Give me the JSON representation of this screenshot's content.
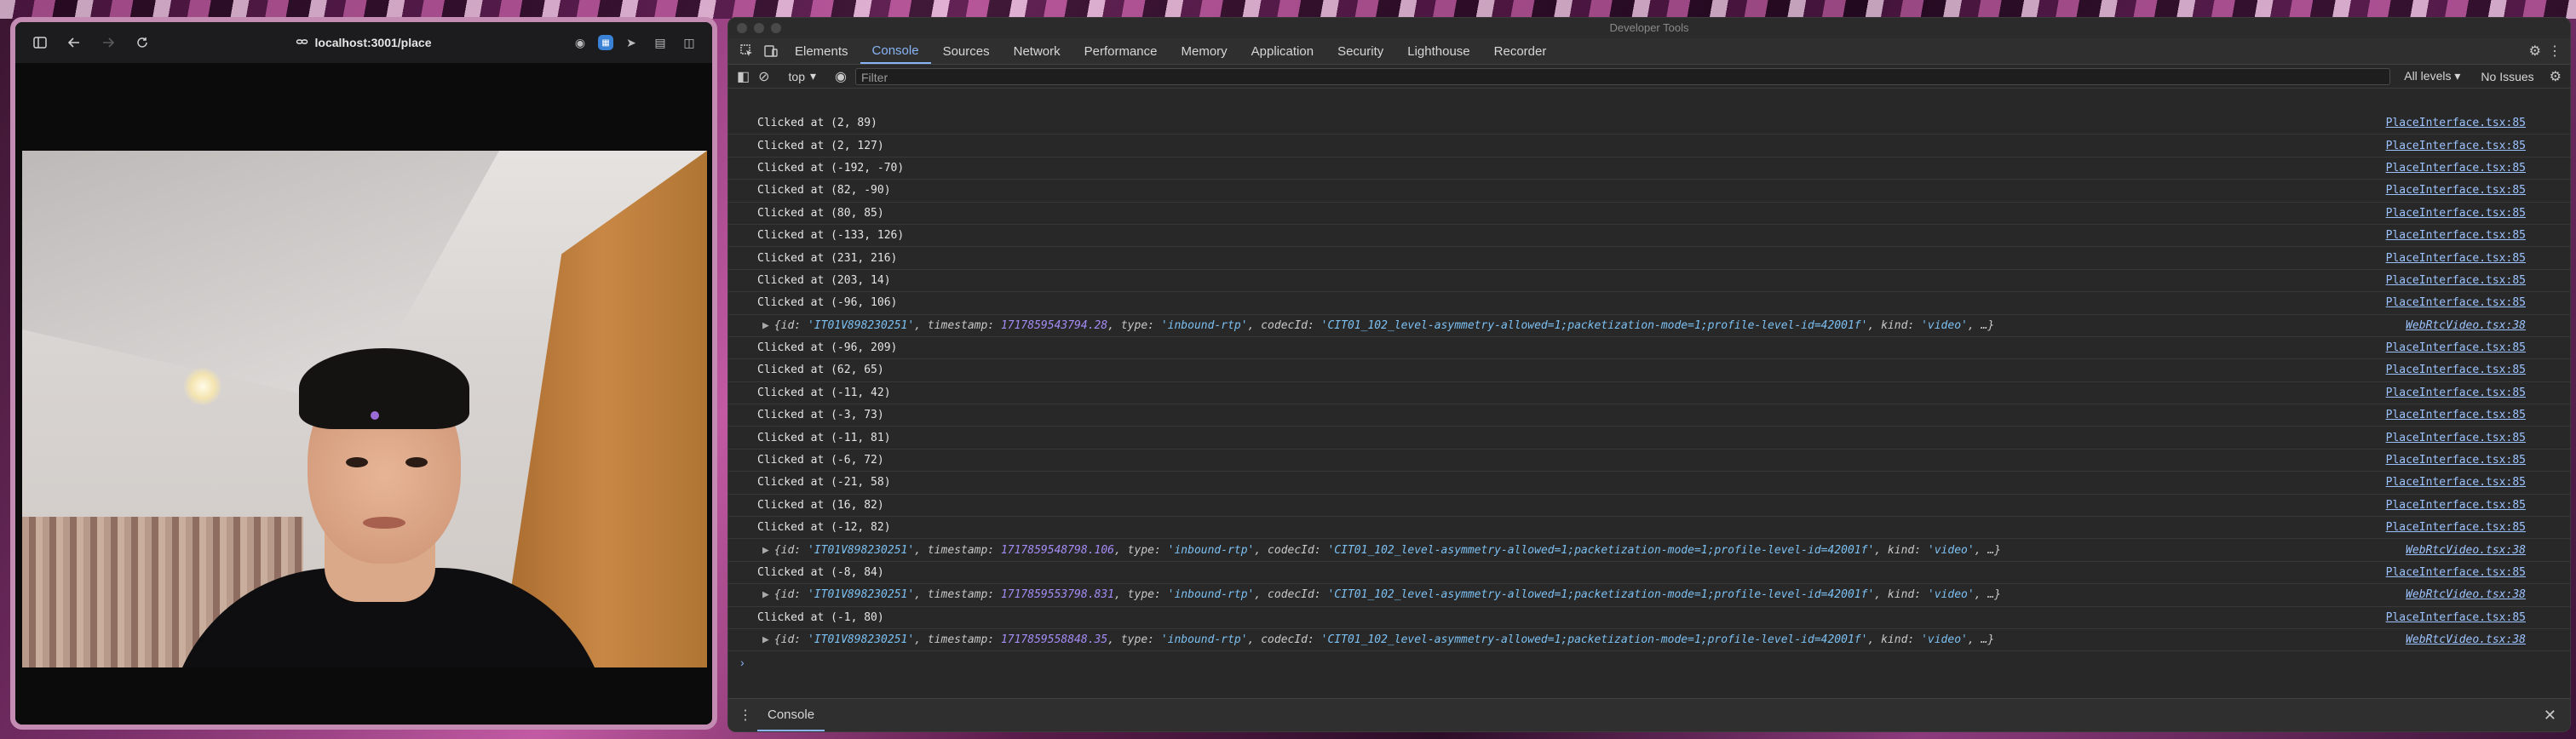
{
  "browser": {
    "url": "localhost:3001/place",
    "icons": [
      "sidebar-icon",
      "back-icon",
      "forward-icon",
      "reload-icon",
      "extension-icon",
      "extension-icon",
      "share-icon",
      "reader-icon",
      "split-view-icon"
    ]
  },
  "devtools": {
    "window_title": "Developer Tools",
    "tabs": [
      "Elements",
      "Console",
      "Sources",
      "Network",
      "Performance",
      "Memory",
      "Application",
      "Security",
      "Lighthouse",
      "Recorder"
    ],
    "active_tab": "Console",
    "context": "top",
    "filter_placeholder": "Filter",
    "levels": "All levels",
    "issues": "No Issues",
    "drawer_tab": "Console",
    "prompt": "›",
    "log_source": "PlaceInterface.tsx:85",
    "obj_source": "WebRtcVideo.tsx:38",
    "obj_lines": [
      {
        "id": "'IT01V898230251'",
        "timestamp": "1717859543794.28",
        "type": "'inbound-rtp'",
        "codecId": "'CIT01_102_level-asymmetry-allowed=1;packetization-mode=1;profile-level-id=42001f'",
        "kind": "'video'"
      },
      {
        "id": "'IT01V898230251'",
        "timestamp": "1717859548798.106",
        "type": "'inbound-rtp'",
        "codecId": "'CIT01_102_level-asymmetry-allowed=1;packetization-mode=1;profile-level-id=42001f'",
        "kind": "'video'"
      },
      {
        "id": "'IT01V898230251'",
        "timestamp": "1717859553798.831",
        "type": "'inbound-rtp'",
        "codecId": "'CIT01_102_level-asymmetry-allowed=1;packetization-mode=1;profile-level-id=42001f'",
        "kind": "'video'"
      },
      {
        "id": "'IT01V898230251'",
        "timestamp": "1717859558848.35",
        "type": "'inbound-rtp'",
        "codecId": "'CIT01_102_level-asymmetry-allowed=1;packetization-mode=1;profile-level-id=42001f'",
        "kind": "'video'"
      }
    ],
    "log": [
      {
        "kind": "text",
        "text": "Clicked at (2, 89)"
      },
      {
        "kind": "text",
        "text": "Clicked at (2, 127)"
      },
      {
        "kind": "text",
        "text": "Clicked at (-192, -70)"
      },
      {
        "kind": "text",
        "text": "Clicked at (82, -90)"
      },
      {
        "kind": "text",
        "text": "Clicked at (80, 85)"
      },
      {
        "kind": "text",
        "text": "Clicked at (-133, 126)"
      },
      {
        "kind": "text",
        "text": "Clicked at (231, 216)"
      },
      {
        "kind": "text",
        "text": "Clicked at (203, 14)"
      },
      {
        "kind": "text",
        "text": "Clicked at (-96, 106)"
      },
      {
        "kind": "obj",
        "index": 0
      },
      {
        "kind": "text",
        "text": "Clicked at (-96, 209)"
      },
      {
        "kind": "text",
        "text": "Clicked at (62, 65)"
      },
      {
        "kind": "text",
        "text": "Clicked at (-11, 42)"
      },
      {
        "kind": "text",
        "text": "Clicked at (-3, 73)"
      },
      {
        "kind": "text",
        "text": "Clicked at (-11, 81)"
      },
      {
        "kind": "text",
        "text": "Clicked at (-6, 72)"
      },
      {
        "kind": "text",
        "text": "Clicked at (-21, 58)"
      },
      {
        "kind": "text",
        "text": "Clicked at (16, 82)"
      },
      {
        "kind": "text",
        "text": "Clicked at (-12, 82)"
      },
      {
        "kind": "obj",
        "index": 1
      },
      {
        "kind": "text",
        "text": "Clicked at (-8, 84)"
      },
      {
        "kind": "obj",
        "index": 2
      },
      {
        "kind": "text",
        "text": "Clicked at (-1, 80)"
      },
      {
        "kind": "obj",
        "index": 3
      }
    ]
  }
}
